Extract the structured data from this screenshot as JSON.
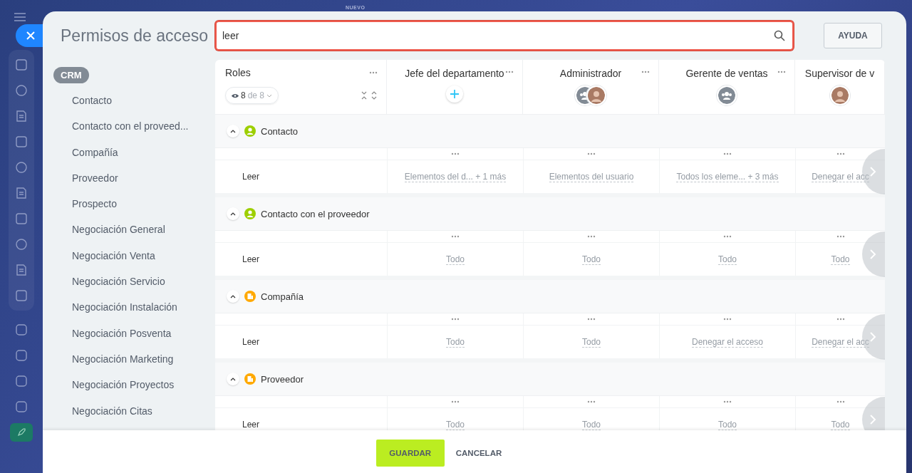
{
  "background": {
    "badge": "NUEVO"
  },
  "title": "Permisos de acceso",
  "search": {
    "value": "leer"
  },
  "help_button": "AYUDA",
  "sidebar": {
    "group": "CRM",
    "items": [
      "Contacto",
      "Contacto con el proveed...",
      "Compañía",
      "Proveedor",
      "Prospecto",
      "Negociación General",
      "Negociación Venta",
      "Negociación Servicio",
      "Negociación Instalación",
      "Negociación Posventa",
      "Negociación Marketing",
      "Negociación Proyectos",
      "Negociación Citas"
    ]
  },
  "table": {
    "roles_header": "Roles",
    "visible_count": "8",
    "visible_total": "de 8",
    "columns": [
      {
        "name": "Jefe del departamento",
        "avatars": [
          {
            "kind": "add"
          }
        ]
      },
      {
        "name": "Administrador",
        "avatars": [
          {
            "kind": "group"
          },
          {
            "kind": "person"
          }
        ]
      },
      {
        "name": "Gerente de ventas",
        "avatars": [
          {
            "kind": "group"
          }
        ]
      },
      {
        "name": "Supervisor de v",
        "avatars": [
          {
            "kind": "person"
          }
        ]
      }
    ],
    "sections": [
      {
        "title": "Contacto",
        "kind": "person",
        "color": "#9dcf00",
        "expanded": true,
        "rows": [
          {
            "label": "Leer",
            "cells": [
              "Elementos del d... + 1 más",
              "Elementos del usuario",
              "Todos los eleme... + 3 más",
              "Denegar el acc"
            ]
          }
        ]
      },
      {
        "title": "Contacto con el proveedor",
        "kind": "person",
        "color": "#9dcf00",
        "expanded": true,
        "rows": [
          {
            "label": "Leer",
            "cells": [
              "Todo",
              "Todo",
              "Todo",
              "Todo"
            ]
          }
        ]
      },
      {
        "title": "Compañía",
        "kind": "company",
        "color": "#ffa900",
        "expanded": true,
        "rows": [
          {
            "label": "Leer",
            "cells": [
              "Todo",
              "Todo",
              "Denegar el acceso",
              "Denegar el acc"
            ]
          }
        ]
      },
      {
        "title": "Proveedor",
        "kind": "company",
        "color": "#ffa900",
        "expanded": true,
        "rows": [
          {
            "label": "Leer",
            "cells": [
              "Todo",
              "Todo",
              "Todo",
              "Todo"
            ]
          }
        ]
      }
    ]
  },
  "footer": {
    "save": "GUARDAR",
    "cancel": "CANCELAR"
  }
}
